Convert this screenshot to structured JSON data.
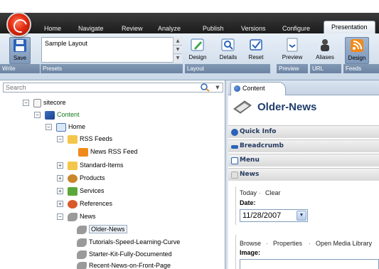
{
  "ribbon": {
    "tabs": [
      "Home",
      "Navigate",
      "Review",
      "Analyze",
      "Publish",
      "Versions",
      "Configure",
      "Presentation"
    ],
    "active_tab": "Presentation",
    "save_label": "Save",
    "presets_value": "Sample Layout",
    "groups": {
      "write": "Write",
      "presets": "Presets",
      "layout": "Layout",
      "preview": "Preview",
      "url": "URL",
      "feeds": "Feeds"
    },
    "buttons": {
      "design": "Design",
      "details": "Details",
      "reset": "Reset",
      "preview": "Preview",
      "aliases": "Aliases",
      "feeds_design": "Design"
    }
  },
  "tree": {
    "search_placeholder": "Search",
    "nodes": {
      "sitecore": "sitecore",
      "content": "Content",
      "home": "Home",
      "rss_feeds": "RSS Feeds",
      "news_rss_feed": "News RSS Feed",
      "standard_items": "Standard-Items",
      "products": "Products",
      "services": "Services",
      "references": "References",
      "news": "News",
      "older_news": "Older-News",
      "tutorials": "Tutorials-Speed-Learning-Curve",
      "starter_kit": "Starter-Kit-Fully-Documented",
      "recent_news": "Recent-News-on-Front-Page"
    }
  },
  "editor": {
    "tab_label": "Content",
    "item_title": "Older-News",
    "sections": {
      "quick_info": "Quick Info",
      "breadcrumb": "Breadcrumb",
      "menu": "Menu",
      "news": "News"
    },
    "date_field": {
      "today": "Today",
      "sep": "·",
      "clear": "Clear",
      "label": "Date:",
      "value": "11/28/2007"
    },
    "image_field": {
      "browse": "Browse",
      "properties": "Properties",
      "open_media_library": "Open Media Library",
      "sep": "·",
      "label": "Image:"
    }
  }
}
